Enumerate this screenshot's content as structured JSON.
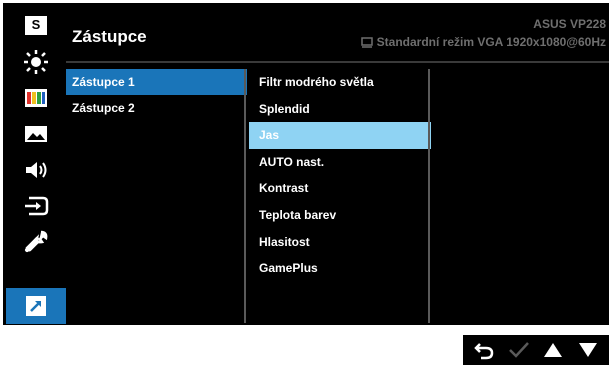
{
  "header": {
    "title": "Zástupce",
    "model": "ASUS  VP228",
    "mode": "Standardní režim  VGA  1920x1080@60Hz"
  },
  "sidebar": {
    "items": [
      {
        "icon": "splendid-s-icon"
      },
      {
        "icon": "blue-light-filter-icon"
      },
      {
        "icon": "color-icon"
      },
      {
        "icon": "image-icon"
      },
      {
        "icon": "sound-icon"
      },
      {
        "icon": "input-select-icon"
      },
      {
        "icon": "system-setup-icon"
      },
      {
        "icon": "shortcut-icon",
        "active": true
      }
    ]
  },
  "submenu": {
    "items": [
      {
        "label": "Zástupce 1",
        "selected": true
      },
      {
        "label": "Zástupce 2"
      }
    ]
  },
  "options": {
    "items": [
      {
        "label": "Filtr modrého světla"
      },
      {
        "label": "Splendid"
      },
      {
        "label": "Jas",
        "selected": true
      },
      {
        "label": "AUTO nast."
      },
      {
        "label": "Kontrast"
      },
      {
        "label": "Teplota barev"
      },
      {
        "label": "Hlasitost"
      },
      {
        "label": "GamePlus"
      }
    ]
  },
  "navbar": {
    "buttons": [
      "back-icon",
      "check-icon",
      "up-arrow-icon",
      "down-arrow-icon"
    ]
  },
  "colors": {
    "accent": "#1a75b9",
    "highlight": "#8fd3f3",
    "background": "#000000",
    "muted_text": "#6f6f6f"
  }
}
